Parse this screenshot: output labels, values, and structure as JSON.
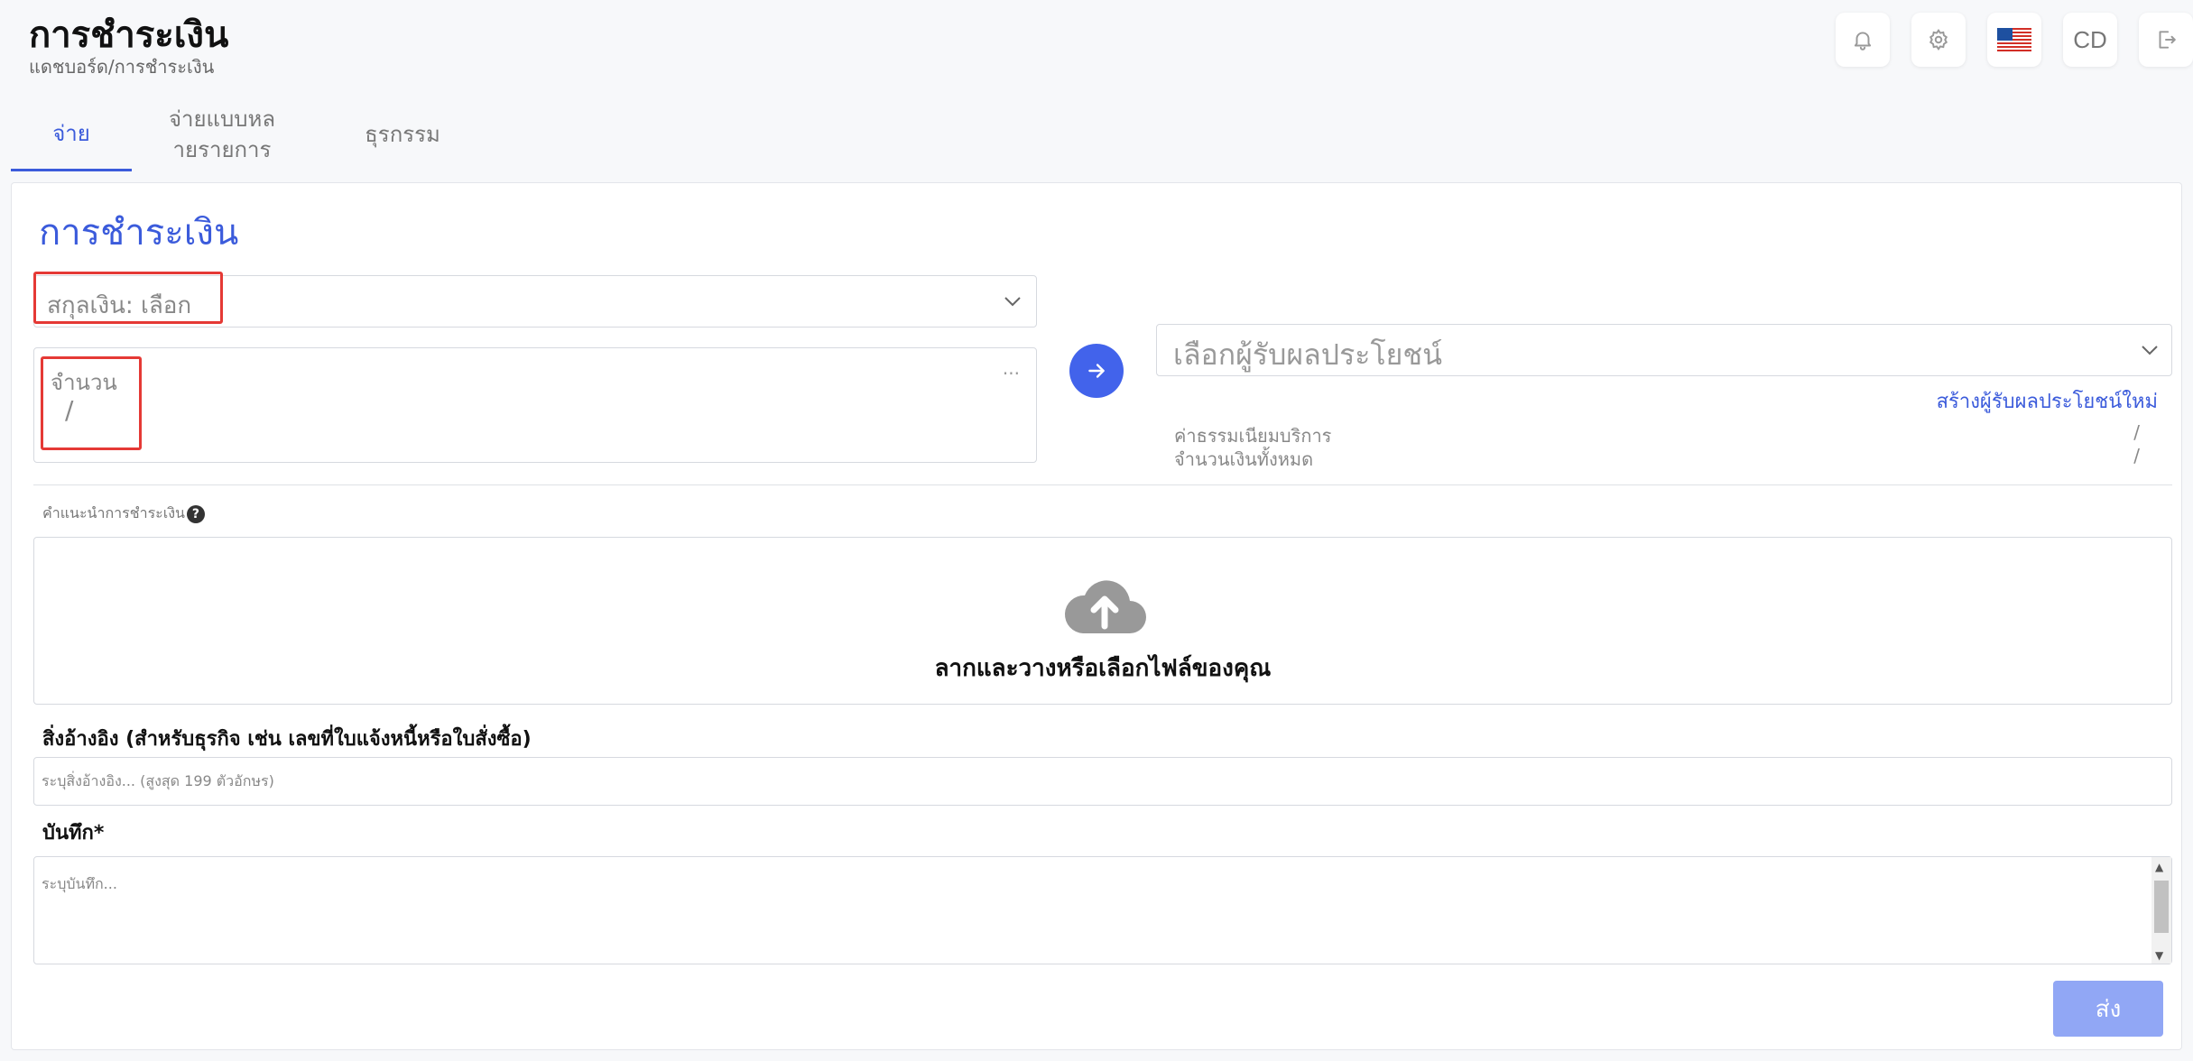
{
  "header": {
    "title": "การชำระเงิน",
    "breadcrumb": "แดชบอร์ด/การชำระเงิน",
    "actions": [
      {
        "icon": "bell-icon"
      },
      {
        "icon": "gear-icon"
      },
      {
        "icon": "us-flag-icon"
      },
      {
        "label": "CD"
      },
      {
        "icon": "logout-icon"
      }
    ]
  },
  "tabs": [
    {
      "label": "จ่าย",
      "active": true
    },
    {
      "label": "จ่ายแบบหลายรายการ",
      "line1": "จ่ายแบบหล",
      "line2": "ายรายการ"
    },
    {
      "label": "ธุรกรรม"
    }
  ],
  "form": {
    "title": "การชำระเงิน",
    "currency_label": "สกุลเงิน:",
    "currency_value": "เลือก",
    "amount_label": "จำนวน",
    "amount_value": "/",
    "amount_more": "...",
    "beneficiary_placeholder": "เลือกผู้รับผลประโยชน์",
    "create_beneficiary": "สร้างผู้รับผลประโยชน์ใหม่",
    "fee_label": "ค่าธรรมเนียมบริการ",
    "fee_value": "/",
    "total_label": "จำนวนเงินทั้งหมด",
    "total_value": "/",
    "instructions_label": "คำแนะนำการชำระเงิน",
    "help": "?",
    "dropzone_text": "ลากและวางหรือเลือกไฟล์ของคุณ",
    "reference_label": "สิ่งอ้างอิง (สำหรับธุรกิจ เช่น เลขที่ใบแจ้งหนี้หรือใบสั่งซื้อ)",
    "reference_placeholder": "ระบุสิ่งอ้างอิง... (สูงสุด 199 ตัวอักษร)",
    "note_label": "บันทึก*",
    "note_placeholder": "ระบุบันทึก...",
    "submit": "ส่ง"
  },
  "colors": {
    "accent": "#3b5bdb",
    "highlight": "#e53935",
    "submit_disabled": "#91a7f5"
  }
}
